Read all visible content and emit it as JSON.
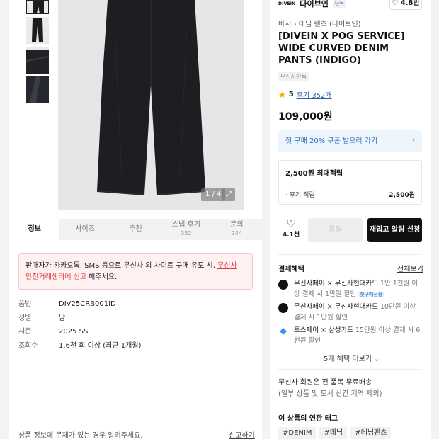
{
  "gallery": {
    "counter": "1 / 4",
    "expand_icon": "expand-icon"
  },
  "tabs": [
    {
      "label": "정보",
      "count": ""
    },
    {
      "label": "사이즈",
      "count": ""
    },
    {
      "label": "추천",
      "count": ""
    },
    {
      "label": "스냅·후기",
      "count": "352"
    },
    {
      "label": "문의",
      "count": "244"
    }
  ],
  "notice": {
    "text_before": "판매자가 카카오톡, SMS 등으로 무신사 외 사이트 구매 유도 시,",
    "link": "무신사 안전거래센터에 신고",
    "text_after": " 해주세요."
  },
  "specs": [
    {
      "key": "품번",
      "value": "DIV25CRB001ID"
    },
    {
      "key": "성별",
      "value": "남"
    },
    {
      "key": "시즌",
      "value": "2025 SS"
    },
    {
      "key": "조회수",
      "value": "1.6천 회 이상 (최근 1개월)"
    }
  ],
  "report": {
    "text": "상품 정보에 문제가 있는 경우 알려주세요.",
    "link": "신고하기"
  },
  "product": {
    "brand_logo": "DIVEIN",
    "brand_name": "다이브인",
    "brand_badge": "단독",
    "likes": "4.8만",
    "breadcrumb_1": "바지",
    "breadcrumb_2": "데님 팬츠 (다이브인)",
    "title": "[DIVEIN X POG SERVICE] WIDE CURVED DENIM PANTS (INDIGO)",
    "exclusive_badge": "무신사단독",
    "rating": "5",
    "review_link": "후기 352개",
    "price": "109,000원",
    "coupon": "첫 구매 20% 쿠폰 받으러 가기"
  },
  "points": {
    "max_label": "2,500원 최대적립",
    "row_label": "· 후기 적립",
    "row_value": "2,500원"
  },
  "actions": {
    "like_count": "4.1천",
    "soldout_label": "품절",
    "restock_label": "재입고 알림 신청"
  },
  "benefits": {
    "title": "결제혜택",
    "view_all": "전체보기",
    "items": [
      {
        "name": "무신사페이 × 무신사현대카드",
        "detail": " 1만 1천원 이상 결제 시 1만원 할인",
        "tag": "첫구매전용"
      },
      {
        "name": "무신사페이 × 무신사현대카드",
        "detail": " 10만원 이상 결제 시 1만원 할인",
        "tag": ""
      },
      {
        "name": "토스페이 × 삼성카드",
        "detail": " 15만원 이상 결제 시 6천원 할인",
        "tag": ""
      }
    ],
    "more": "5개 혜택 더보기"
  },
  "shipping": {
    "line1": "무신사 회원은 전 품목 무료배송",
    "line2": "(일부 상품 및 도서 산간 지역 제외)"
  },
  "related_tags": {
    "title": "이 상품의 연관 태그",
    "items": [
      "#DENIM",
      "#데님",
      "#데님팬츠"
    ]
  }
}
